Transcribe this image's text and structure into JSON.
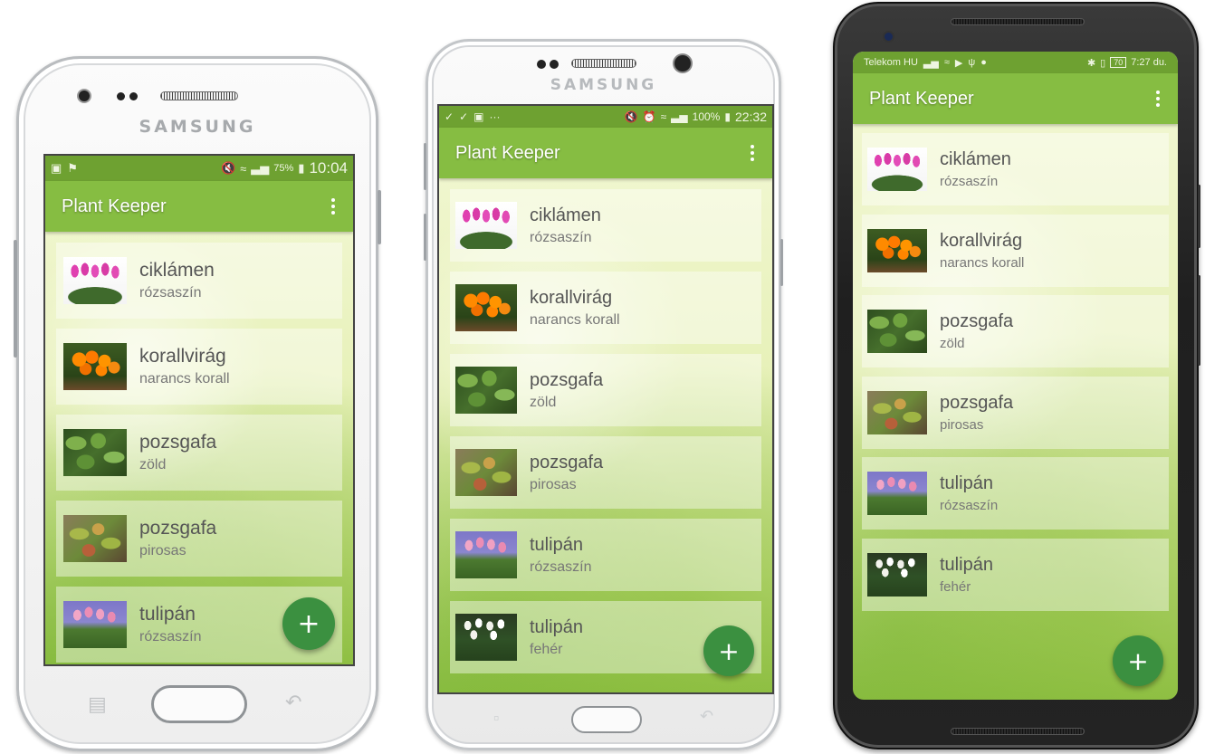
{
  "app": {
    "title": "Plant Keeper",
    "fab_label": "+",
    "primary_color": "#86bd42",
    "status_color": "#6ea131",
    "fab_color": "#3b9040"
  },
  "devices": [
    {
      "brand": "SAMSUNG",
      "status": {
        "left_icons": [
          "image-icon",
          "checkmark-flag-icon"
        ],
        "right_icons": [
          "mute-icon",
          "wifi-icon",
          "signal-icon"
        ],
        "battery": "75%",
        "time": "10:04"
      },
      "plants": [
        {
          "name": "ciklámen",
          "color": "rózsaszín",
          "image": "cyclamen"
        },
        {
          "name": "korallvirág",
          "color": "narancs korall",
          "image": "kalanchoe"
        },
        {
          "name": "pozsgafa",
          "color": "zöld",
          "image": "jade-green"
        },
        {
          "name": "pozsgafa",
          "color": "pirosas",
          "image": "jade-reddish"
        },
        {
          "name": "tulipán",
          "color": "rózsaszín",
          "image": "tulip-pink"
        }
      ]
    },
    {
      "brand": "SAMSUNG",
      "status": {
        "left_icons": [
          "download-done-icon",
          "download-done-icon",
          "image-icon"
        ],
        "left_more": "···",
        "right_icons": [
          "mute-icon",
          "alarm-icon",
          "wifi-icon",
          "signal-icon"
        ],
        "battery": "100%",
        "time": "22:32"
      },
      "plants": [
        {
          "name": "ciklámen",
          "color": "rózsaszín",
          "image": "cyclamen"
        },
        {
          "name": "korallvirág",
          "color": "narancs korall",
          "image": "kalanchoe"
        },
        {
          "name": "pozsgafa",
          "color": "zöld",
          "image": "jade-green"
        },
        {
          "name": "pozsgafa",
          "color": "pirosas",
          "image": "jade-reddish"
        },
        {
          "name": "tulipán",
          "color": "rózsaszín",
          "image": "tulip-pink"
        },
        {
          "name": "tulipán",
          "color": "fehér",
          "image": "tulip-white"
        }
      ]
    },
    {
      "status": {
        "carrier": "Telekom HU",
        "left_icons": [
          "signal-icon",
          "wifi-icon",
          "play-icon",
          "usb-icon",
          "chat-icon"
        ],
        "right_icons": [
          "bluetooth-icon",
          "vibrate-icon",
          "battery-icon"
        ],
        "battery": "70",
        "time": "7:27 du."
      },
      "plants": [
        {
          "name": "ciklámen",
          "color": "rózsaszín",
          "image": "cyclamen"
        },
        {
          "name": "korallvirág",
          "color": "narancs korall",
          "image": "kalanchoe"
        },
        {
          "name": "pozsgafa",
          "color": "zöld",
          "image": "jade-green"
        },
        {
          "name": "pozsgafa",
          "color": "pirosas",
          "image": "jade-reddish"
        },
        {
          "name": "tulipán",
          "color": "rózsaszín",
          "image": "tulip-pink"
        },
        {
          "name": "tulipán",
          "color": "fehér",
          "image": "tulip-white"
        }
      ]
    }
  ]
}
